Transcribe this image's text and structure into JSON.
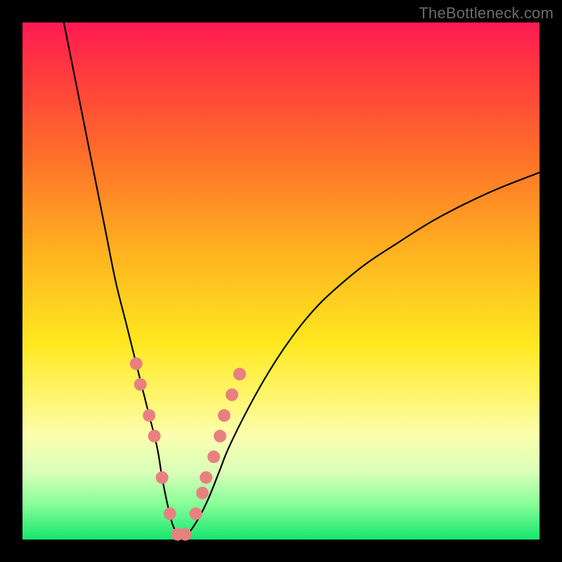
{
  "watermark": "TheBottleneck.com",
  "colors": {
    "background": "#000000",
    "watermark": "#6b6b6b",
    "curve": "#000000",
    "marker_fill": "#e98080",
    "marker_stroke": "#d46a6a"
  },
  "chart_data": {
    "type": "line",
    "title": "",
    "xlabel": "",
    "ylabel": "",
    "xlim": [
      0,
      100
    ],
    "ylim": [
      0,
      100
    ],
    "grid": false,
    "legend": false,
    "series": [
      {
        "name": "bottleneck-curve",
        "x": [
          8,
          10,
          12,
          14,
          16,
          18,
          20,
          22,
          24,
          26,
          27,
          28,
          29,
          30,
          31,
          32,
          34,
          36,
          38,
          40,
          44,
          48,
          52,
          56,
          60,
          66,
          72,
          80,
          90,
          100
        ],
        "y": [
          100,
          90,
          80,
          70,
          60,
          50,
          42,
          34,
          26,
          18,
          12,
          7,
          3,
          1,
          0,
          1,
          4,
          8,
          13,
          18,
          26,
          33,
          39,
          44,
          48,
          53,
          57,
          62,
          67,
          71
        ]
      }
    ],
    "markers": {
      "name": "highlight-dots",
      "x": [
        22.0,
        22.8,
        24.5,
        25.5,
        27.0,
        28.5,
        30.0,
        31.5,
        33.5,
        34.8,
        35.5,
        37.0,
        38.2,
        39.0,
        40.5,
        42.0
      ],
      "y": [
        34,
        30,
        24,
        20,
        12,
        5,
        1,
        1,
        5,
        9,
        12,
        16,
        20,
        24,
        28,
        32
      ]
    }
  }
}
